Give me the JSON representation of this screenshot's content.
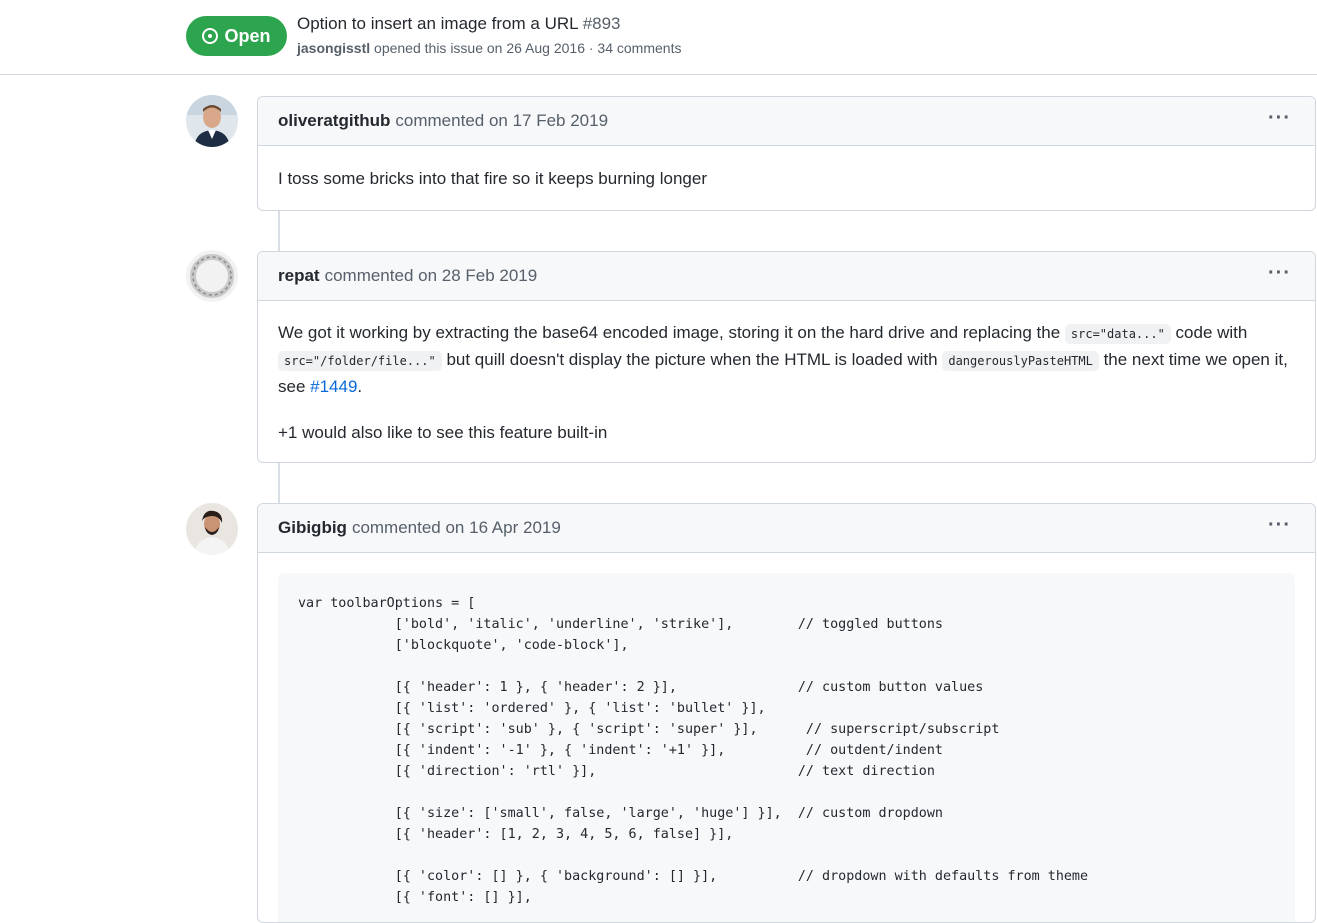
{
  "issue": {
    "state": "Open",
    "title": "Option to insert an image from a URL",
    "number": "#893",
    "author": "jasongisstl",
    "meta": "opened this issue on 26 Aug 2016 · 34 comments"
  },
  "comments": [
    {
      "author": "oliveratgithub",
      "date": "commented on 17 Feb 2019",
      "menu": "···",
      "body": "I toss some bricks into that fire so it keeps burning longer"
    },
    {
      "author": "repat",
      "date": "commented on 28 Feb 2019",
      "menu": "···",
      "p1_a": "We got it working by extracting the base64 encoded image, storing it on the hard drive and replacing the ",
      "code1": "src=\"data...\"",
      "p1_b": " code with ",
      "code2": "src=\"/folder/file...\"",
      "p1_c": " but quill doesn't display the picture when the HTML is loaded with ",
      "code3": "dangerouslyPasteHTML",
      "p1_d": " the next time we open it, see ",
      "link": "#1449",
      "p1_e": ".",
      "p2": "+1 would also like to see this feature built-in"
    },
    {
      "author": "Gibigbig",
      "date": "commented on 16 Apr 2019",
      "menu": "···",
      "code": "var toolbarOptions = [\n            ['bold', 'italic', 'underline', 'strike'],        // toggled buttons\n            ['blockquote', 'code-block'],\n\n            [{ 'header': 1 }, { 'header': 2 }],               // custom button values\n            [{ 'list': 'ordered' }, { 'list': 'bullet' }],\n            [{ 'script': 'sub' }, { 'script': 'super' }],      // superscript/subscript\n            [{ 'indent': '-1' }, { 'indent': '+1' }],          // outdent/indent\n            [{ 'direction': 'rtl' }],                         // text direction\n\n            [{ 'size': ['small', false, 'large', 'huge'] }],  // custom dropdown\n            [{ 'header': [1, 2, 3, 4, 5, 6, false] }],\n\n            [{ 'color': [] }, { 'background': [] }],          // dropdown with defaults from theme\n            [{ 'font': [] }],"
    }
  ]
}
